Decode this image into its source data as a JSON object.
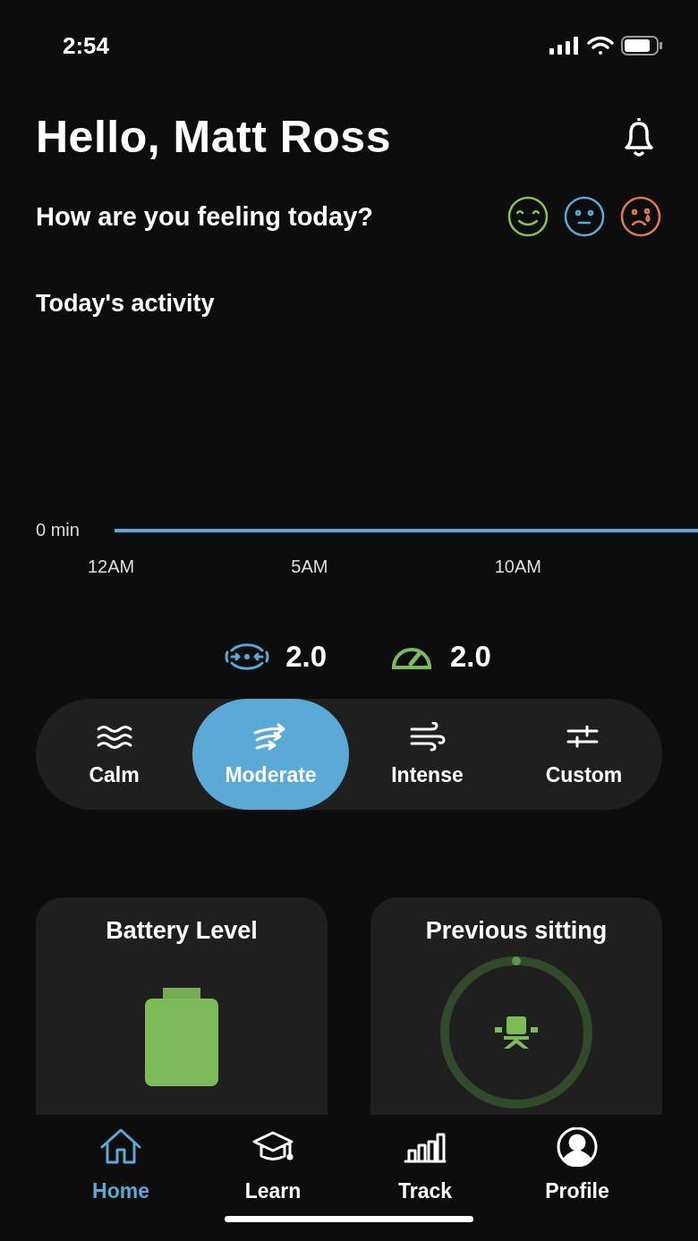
{
  "status_bar": {
    "time": "2:54"
  },
  "header": {
    "greeting": "Hello, Matt Ross",
    "question": "How are you feeling today?"
  },
  "moods": [
    {
      "kind": "happy",
      "color": "#8bc34a"
    },
    {
      "kind": "neutral",
      "color": "#5aa9d6"
    },
    {
      "kind": "sad",
      "color": "#e07a4f"
    }
  ],
  "activity": {
    "title": "Today's activity",
    "y_label": "0 min",
    "x_labels": [
      "12AM",
      "5AM",
      "10AM"
    ]
  },
  "stats": [
    {
      "kind": "breath",
      "value": "2.0"
    },
    {
      "kind": "speed",
      "value": "2.0"
    }
  ],
  "modes": [
    {
      "kind": "calm",
      "label": "Calm",
      "selected": false
    },
    {
      "kind": "moderate",
      "label": "Moderate",
      "selected": true
    },
    {
      "kind": "intense",
      "label": "Intense",
      "selected": false
    },
    {
      "kind": "custom",
      "label": "Custom",
      "selected": false
    }
  ],
  "cards": [
    {
      "kind": "battery",
      "title": "Battery Level"
    },
    {
      "kind": "sitting",
      "title": "Previous sitting"
    }
  ],
  "tabs": [
    {
      "kind": "home",
      "label": "Home",
      "selected": true
    },
    {
      "kind": "learn",
      "label": "Learn",
      "selected": false
    },
    {
      "kind": "track",
      "label": "Track",
      "selected": false
    },
    {
      "kind": "profile",
      "label": "Profile",
      "selected": false
    }
  ]
}
